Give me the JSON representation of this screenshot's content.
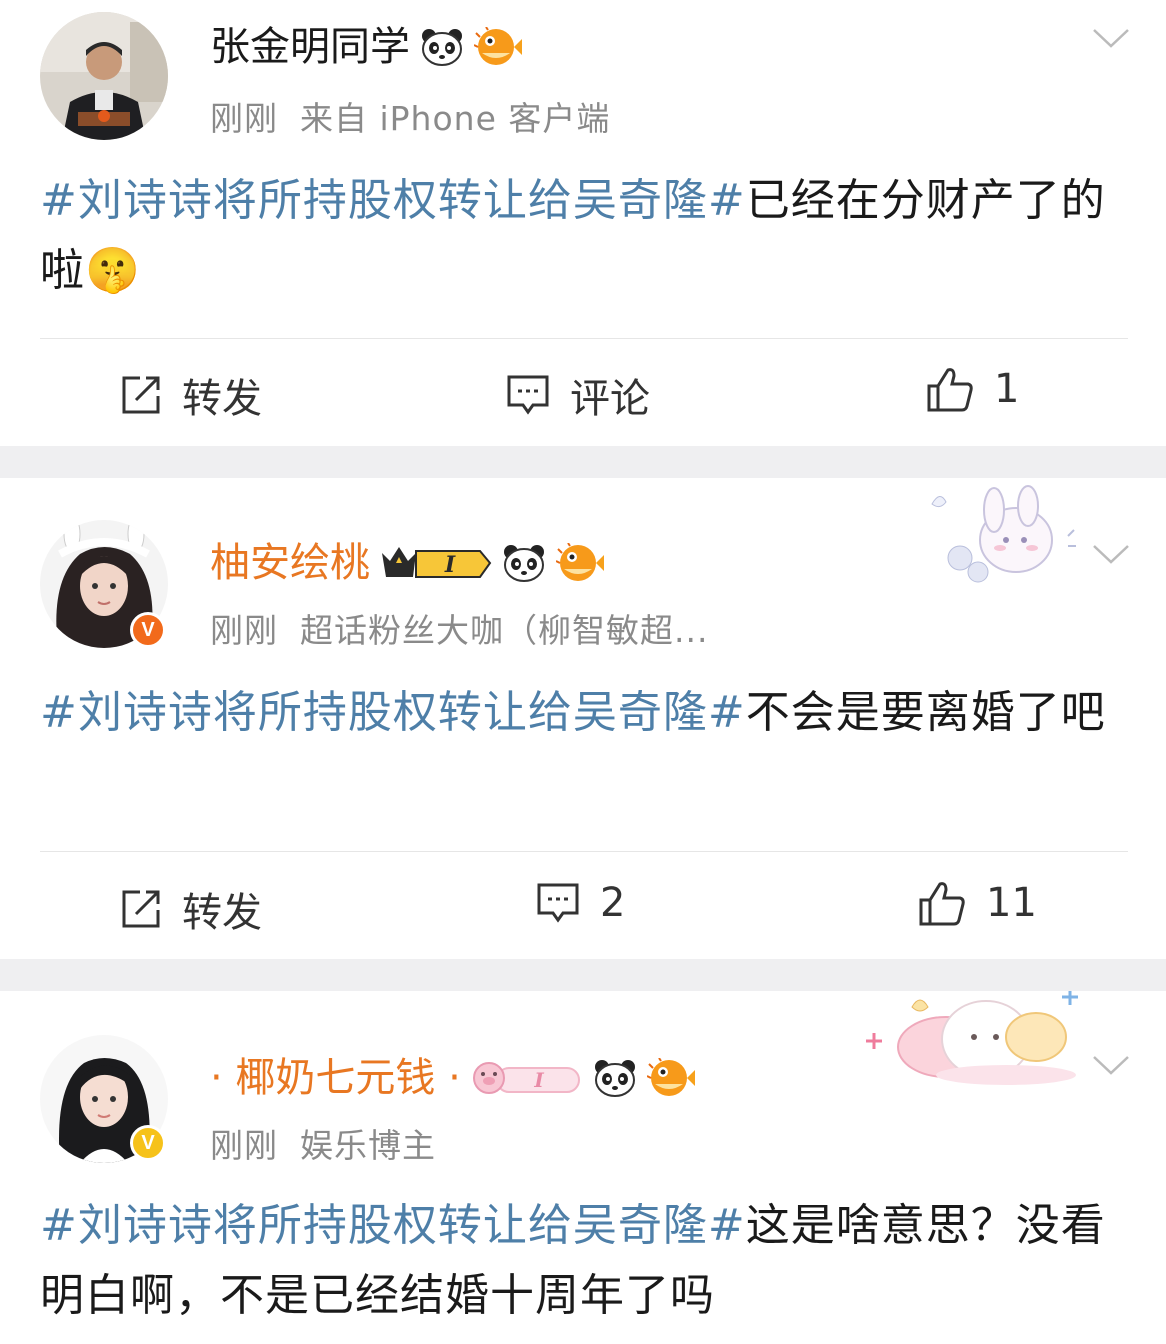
{
  "posts": [
    {
      "username": "张金明同学",
      "time": "刚刚",
      "source": "来自 iPhone 客户端",
      "hashtag": "#刘诗诗将所持股权转让给吴奇隆#",
      "text": "已经在分财产了的啦",
      "emoji": "🤫",
      "actions": {
        "repost": "转发",
        "comment": "评论",
        "like": "1"
      }
    },
    {
      "username": "柚安绘桃",
      "time": "刚刚",
      "source": "超话粉丝大咖（柳智敏超...",
      "hashtag": "#刘诗诗将所持股权转让给吴奇隆#",
      "text": "不会是要离婚了吧",
      "badge_text": "I",
      "actions": {
        "repost": "转发",
        "comment": "2",
        "like": "11"
      }
    },
    {
      "username": "· 椰奶七元钱 ·",
      "time": "刚刚",
      "source": "娱乐博主",
      "hashtag": "#刘诗诗将所持股权转让给吴奇隆#",
      "text": "这是啥意思？没看明白啊，不是已经结婚十周年了吗",
      "badge_text": "I"
    }
  ],
  "colors": {
    "hashtag": "#4e7fa8",
    "vip_name": "#e87722",
    "meta": "#8a8a8a",
    "separator": "#efeff1"
  },
  "icons": [
    "panda-icon",
    "pufferfish-icon",
    "chevron-down-icon",
    "repost-icon",
    "comment-icon",
    "like-icon",
    "crown-badge-icon",
    "verified-badge-icon"
  ]
}
